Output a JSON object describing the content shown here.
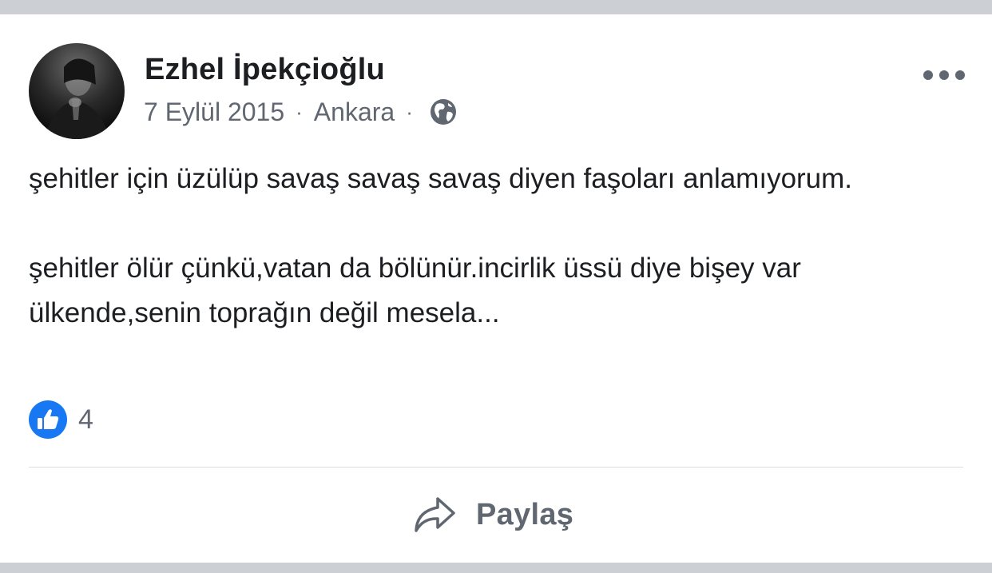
{
  "post": {
    "author": "Ezhel İpekçioğlu",
    "date": "7 Eylül 2015",
    "location": "Ankara",
    "separator": "·",
    "privacy_icon": "globe-icon",
    "paragraphs": [
      "şehitler için üzülüp savaş savaş savaş diyen faşoları anlamıyorum.",
      "şehitler ölür çünkü,vatan da bölünür.incirlik üssü diye bişey var ülkende,senin toprağın değil mesela..."
    ]
  },
  "reactions": {
    "icon": "like-icon",
    "count": "4"
  },
  "actions": {
    "share_label": "Paylaş",
    "share_icon": "share-arrow-icon",
    "more_icon": "more-options-icon"
  },
  "colors": {
    "background": "#ccd0d5",
    "card": "#ffffff",
    "text_primary": "#1c1e21",
    "text_secondary": "#606770",
    "like_blue": "#1877f2",
    "divider": "#dadde1"
  }
}
